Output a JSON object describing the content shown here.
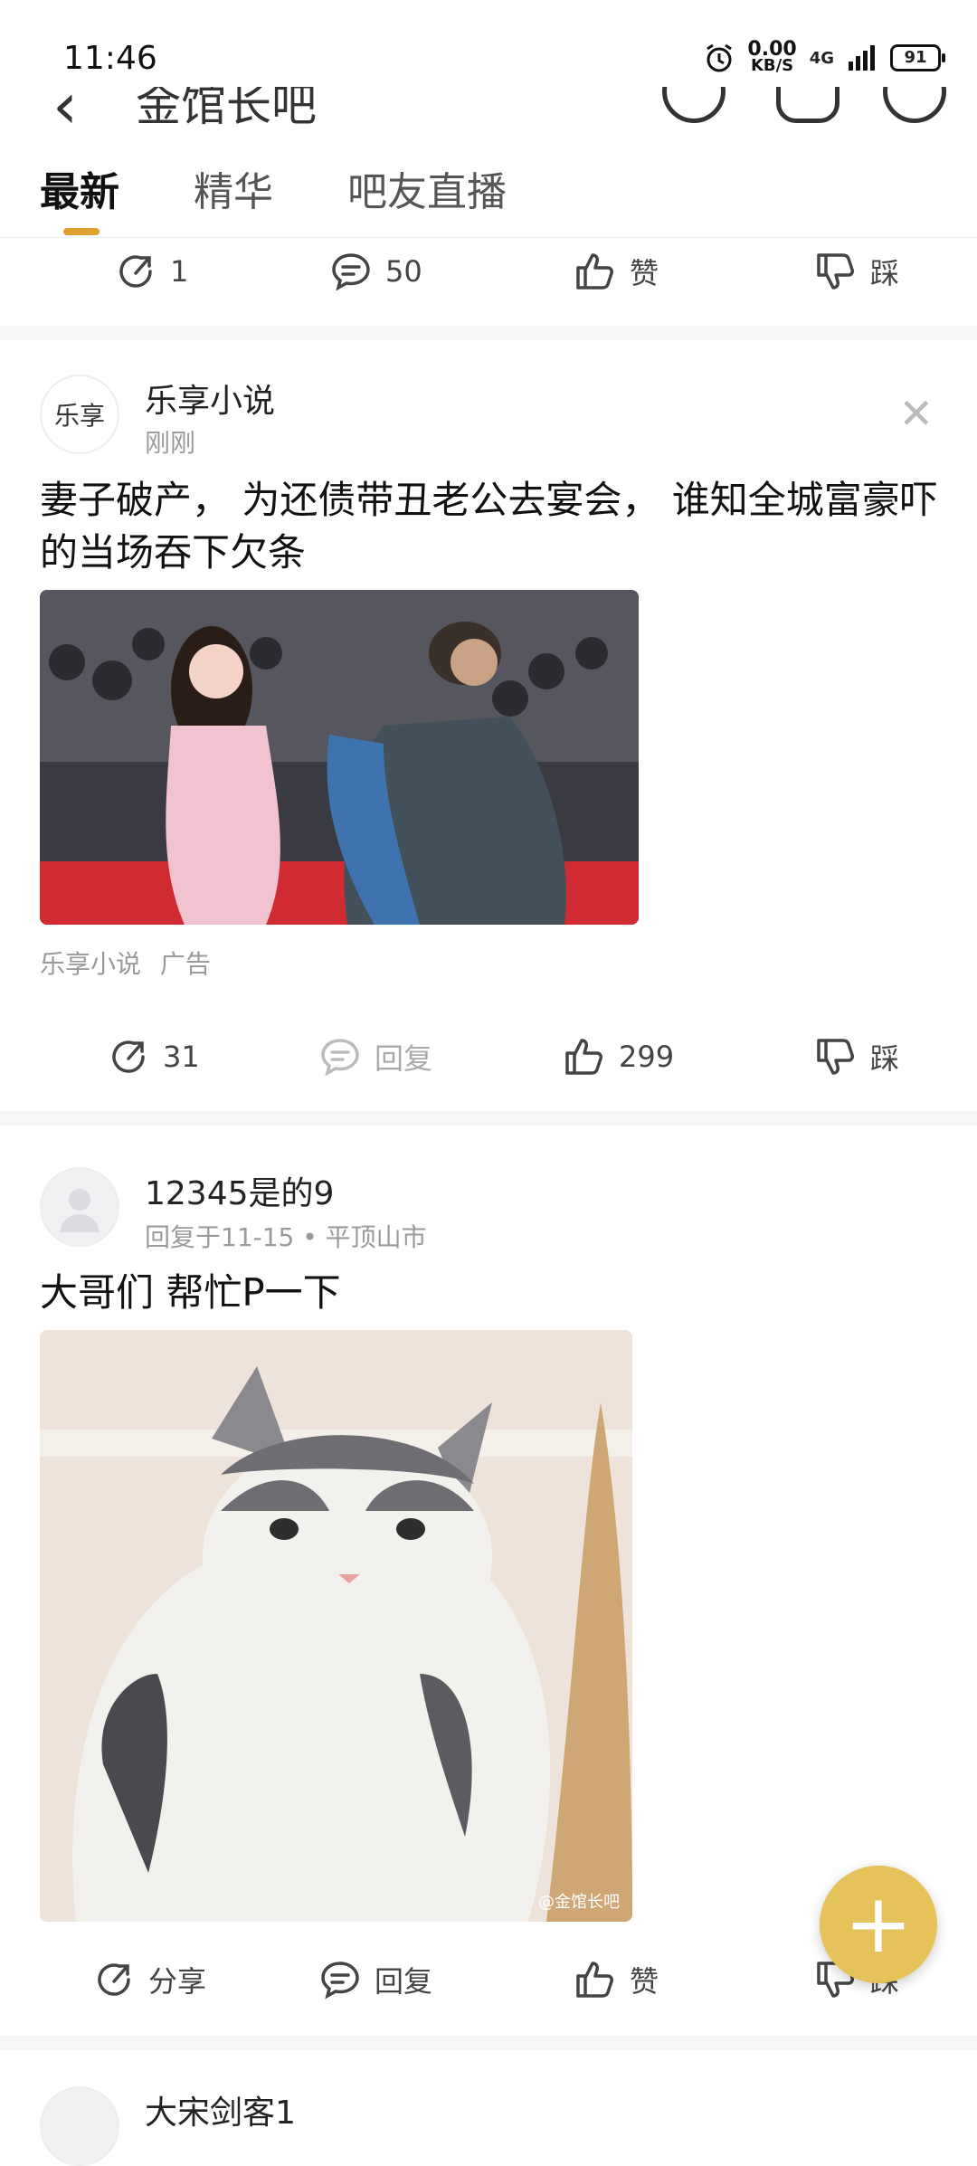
{
  "status": {
    "time": "11:46",
    "speed_value": "0.00",
    "speed_unit": "KB/S",
    "network": "4G",
    "battery": "91"
  },
  "header": {
    "forum_title": "金馆长吧"
  },
  "tabs": [
    {
      "label": "最新"
    },
    {
      "label": "精华"
    },
    {
      "label": "吧友直播"
    }
  ],
  "prev_post": {
    "share_count": "1",
    "comment_count": "50",
    "like_label": "赞",
    "dislike_label": "踩"
  },
  "ad_post": {
    "avatar_text": "乐享",
    "author": "乐享小说",
    "time": "刚刚",
    "title": "妻子破产， 为还债带丑老公去宴会， 谁知全城富豪吓的当场吞下欠条",
    "source": "乐享小说",
    "ad_tag": "广告",
    "share_count": "31",
    "reply_label": "回复",
    "like_count": "299",
    "dislike_label": "踩"
  },
  "post2": {
    "author": "12345是的9",
    "meta": "回复于11-15 • 平顶山市",
    "title": "大哥们 帮忙P一下",
    "watermark": "@金馆长吧",
    "share_label": "分享",
    "reply_label": "回复",
    "like_label": "赞",
    "dislike_label": "踩"
  },
  "next_post": {
    "author": "大宋剑客1"
  },
  "colors": {
    "accent": "#e0a030",
    "fab": "#e6c25a"
  }
}
